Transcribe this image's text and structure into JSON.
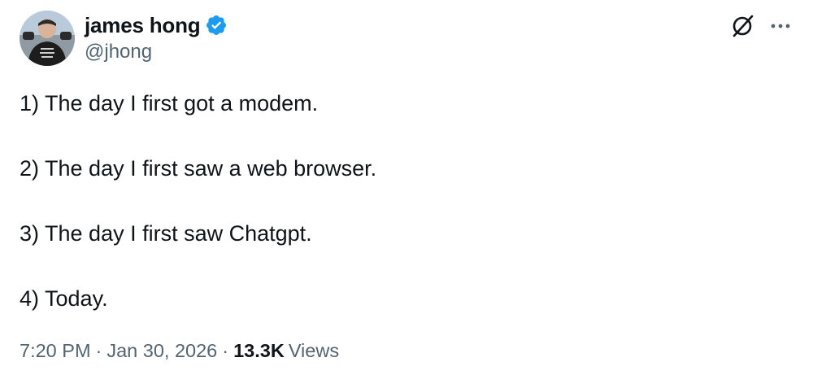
{
  "author": {
    "display_name": "james hong",
    "handle": "@jhong"
  },
  "tweet": {
    "lines": [
      "1) The day I first got a modem.",
      "2) The day I first saw a web browser.",
      "3) The day I first saw Chatgpt.",
      "4) Today."
    ]
  },
  "meta": {
    "time": "7:20 PM",
    "separator": "·",
    "date": "Jan 30, 2026",
    "views_count": "13.3K",
    "views_label": "Views"
  },
  "icons": {
    "verified": "verified-badge-icon",
    "grok": "grok-icon",
    "more": "more-options-icon"
  },
  "colors": {
    "text_primary": "#0f1419",
    "text_secondary": "#536471",
    "verified_blue": "#1d9bf0",
    "background": "#ffffff"
  }
}
